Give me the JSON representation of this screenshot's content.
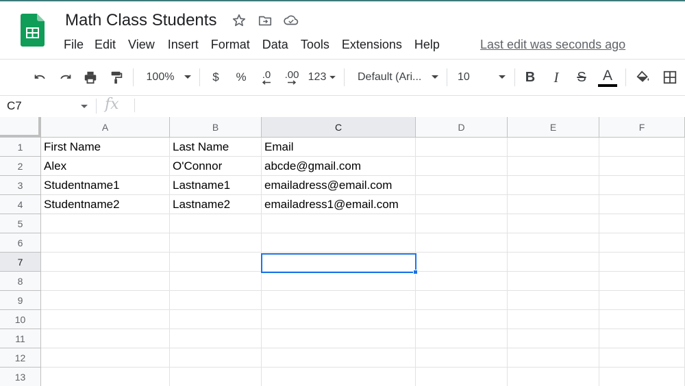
{
  "doc": {
    "title": "Math Class Students",
    "last_edit": "Last edit was seconds ago"
  },
  "title_icons": [
    "star-icon",
    "move-to-folder-icon",
    "cloud-saved-icon"
  ],
  "menu": [
    "File",
    "Edit",
    "View",
    "Insert",
    "Format",
    "Data",
    "Tools",
    "Extensions",
    "Help"
  ],
  "toolbar": {
    "zoom": "100%",
    "currency": "$",
    "percent": "%",
    "decrease_decimal": ".0",
    "increase_decimal": ".00",
    "more_formats": "123",
    "font": "Default (Ari...",
    "font_size": "10",
    "bold": "B",
    "italic": "I",
    "strike": "S",
    "text_color": "A"
  },
  "formula_bar": {
    "cell_ref": "C7",
    "fx": "fx",
    "value": ""
  },
  "columns": [
    "A",
    "B",
    "C",
    "D",
    "E",
    "F"
  ],
  "rows": [
    "1",
    "2",
    "3",
    "4",
    "5",
    "6",
    "7",
    "8",
    "9",
    "10",
    "11",
    "12",
    "13"
  ],
  "cells": [
    [
      "First Name",
      "Last Name",
      "Email",
      "",
      "",
      ""
    ],
    [
      "Alex",
      "O'Connor",
      "abcde@gmail.com",
      "",
      "",
      ""
    ],
    [
      "Studentname1",
      "Lastname1",
      "emailadress@email.com",
      "",
      "",
      ""
    ],
    [
      "Studentname2",
      "Lastname2",
      "emailadress1@email.com",
      "",
      "",
      ""
    ],
    [
      "",
      "",
      "",
      "",
      "",
      ""
    ],
    [
      "",
      "",
      "",
      "",
      "",
      ""
    ],
    [
      "",
      "",
      "",
      "",
      "",
      ""
    ],
    [
      "",
      "",
      "",
      "",
      "",
      ""
    ],
    [
      "",
      "",
      "",
      "",
      "",
      ""
    ],
    [
      "",
      "",
      "",
      "",
      "",
      ""
    ],
    [
      "",
      "",
      "",
      "",
      "",
      ""
    ],
    [
      "",
      "",
      "",
      "",
      "",
      ""
    ],
    [
      "",
      "",
      "",
      "",
      "",
      ""
    ]
  ],
  "selected": {
    "col": "C",
    "row": "7"
  },
  "colors": {
    "accent": "#1a73e8",
    "sheets_green": "#0f9d58"
  }
}
